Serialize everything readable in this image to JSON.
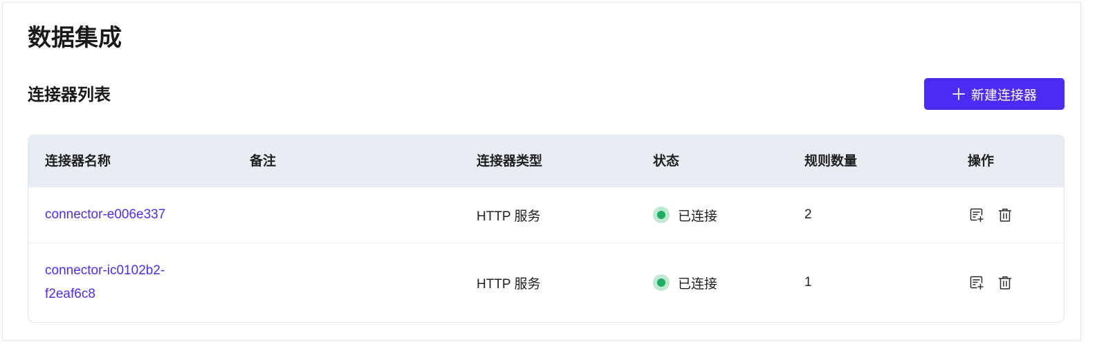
{
  "page": {
    "title": "数据集成"
  },
  "section": {
    "title": "连接器列表",
    "new_button_label": "新建连接器"
  },
  "table": {
    "headers": {
      "name": "连接器名称",
      "note": "备注",
      "type": "连接器类型",
      "status": "状态",
      "rules": "规则数量",
      "ops": "操作"
    },
    "rows": [
      {
        "name_line1": "connector-e006e337",
        "name_line2": "",
        "note": "",
        "type": "HTTP 服务",
        "status": "已连接",
        "rules": "2"
      },
      {
        "name_line1": "connector-ic0102b2-",
        "name_line2": "f2eaf6c8",
        "note": "",
        "type": "HTTP 服务",
        "status": "已连接",
        "rules": "1"
      }
    ]
  },
  "icons": {
    "add": "plus-icon",
    "edit_rules": "document-add-icon",
    "delete": "trash-icon"
  },
  "colors": {
    "accent": "#4a2cf5",
    "status_connected": "#1fae5f",
    "status_connected_halo": "#bfe9d3",
    "table_header_bg": "#e8ecf3"
  }
}
